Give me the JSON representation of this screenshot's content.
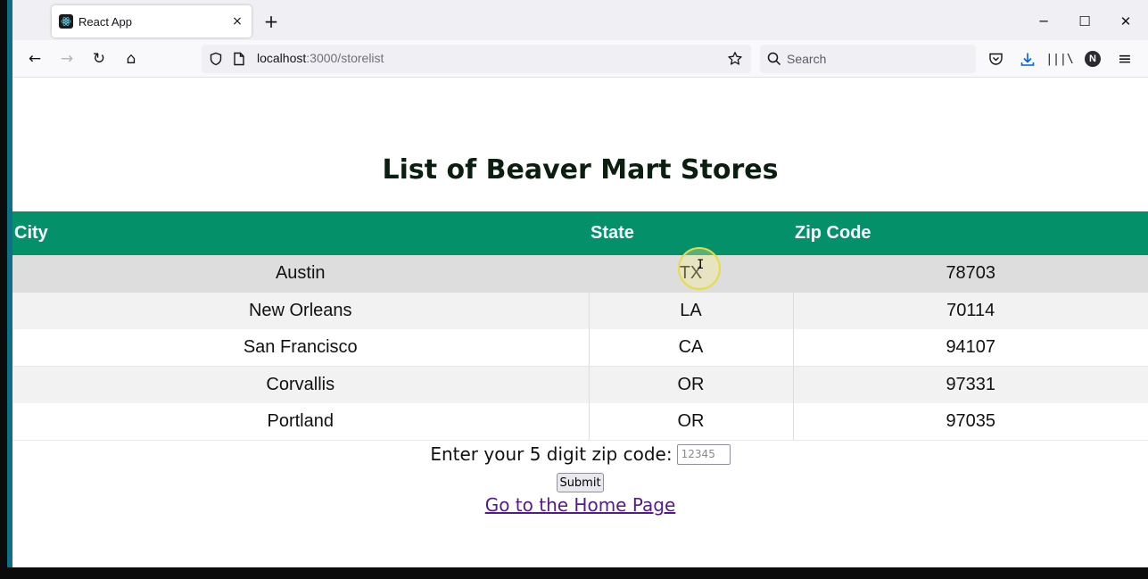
{
  "browser": {
    "tab": {
      "title": "React App",
      "favicon": "react-logo-icon",
      "close_glyph": "×"
    },
    "new_tab_glyph": "+",
    "window_controls": {
      "minimize": "─",
      "maximize": "☐",
      "close": "✕"
    },
    "nav": {
      "back": "←",
      "forward": "→",
      "reload": "↻",
      "home": "⌂"
    },
    "url": {
      "host": "localhost",
      "path": ":3000/storelist"
    },
    "search": {
      "placeholder": "Search"
    },
    "account_initial": "N",
    "library_glyph": "|||\\",
    "menu_glyph": "≡"
  },
  "page": {
    "title": "List of Beaver Mart Stores",
    "table": {
      "headers": {
        "city": "City",
        "state": "State",
        "zip": "Zip Code"
      },
      "rows": [
        {
          "city": "Austin",
          "state": "TX",
          "zip": "78703"
        },
        {
          "city": "New Orleans",
          "state": "LA",
          "zip": "70114"
        },
        {
          "city": "San Francisco",
          "state": "CA",
          "zip": "94107"
        },
        {
          "city": "Corvallis",
          "state": "OR",
          "zip": "97331"
        },
        {
          "city": "Portland",
          "state": "OR",
          "zip": "97035"
        }
      ]
    },
    "form": {
      "label": "Enter your 5 digit zip code:",
      "placeholder": "12345",
      "submit": "Submit"
    },
    "home_link": "Go to the Home Page"
  },
  "colors": {
    "header_bg": "#049069",
    "link": "#551a8b",
    "title": "#0a1f0f"
  }
}
